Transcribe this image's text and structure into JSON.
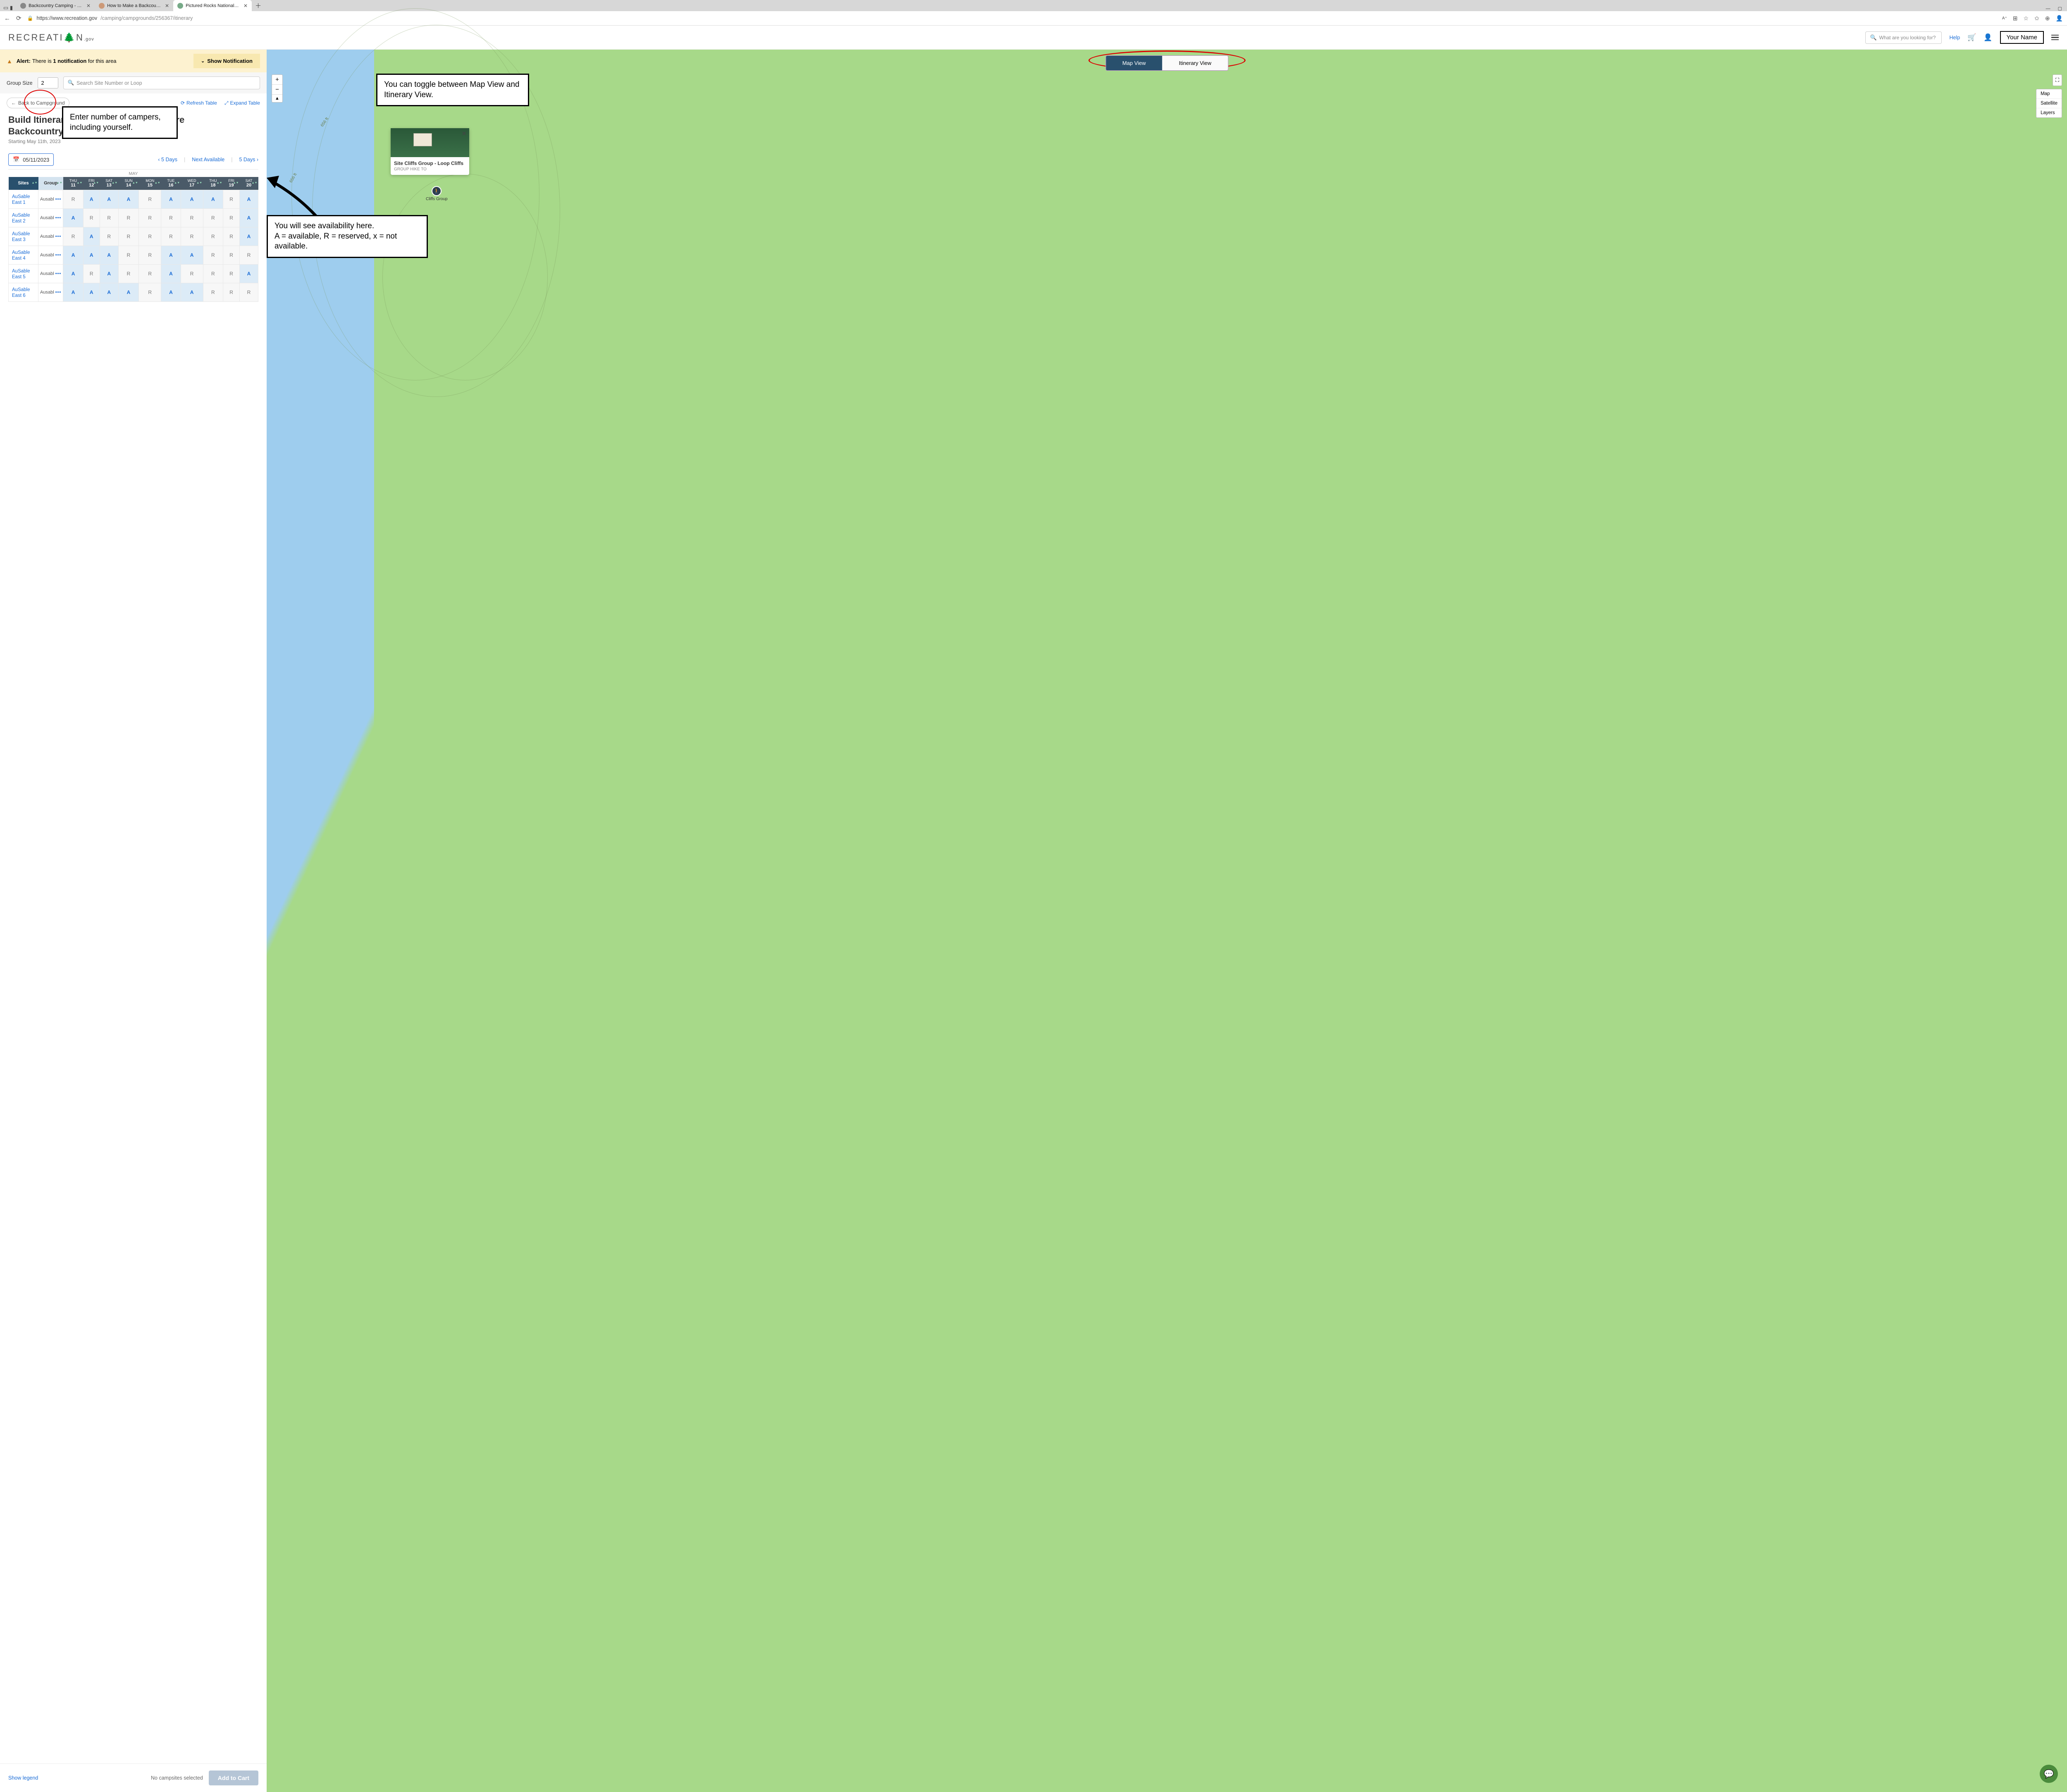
{
  "browser": {
    "tabs": [
      {
        "title": "Backcountry Camping - Pictured"
      },
      {
        "title": "How to Make a Backcountry Cam"
      },
      {
        "title": "Pictured Rocks National Lakesho"
      }
    ],
    "url_host": "https://www.recreation.gov",
    "url_path": "/camping/campgrounds/256367/itinerary"
  },
  "header": {
    "logo_main": "RECREATI",
    "logo_o": "☼",
    "logo_n": "N",
    "logo_gov": ".gov",
    "search_placeholder": "What are you looking for?",
    "help": "Help",
    "your_name": "Your Name"
  },
  "alert": {
    "label": "Alert:",
    "text_pre": "There is ",
    "count": "1 notification",
    "text_post": " for this area",
    "show": "Show Notification"
  },
  "filters": {
    "group_label": "Group Size",
    "group_value": "2",
    "site_search_placeholder": "Search Site Number or Loop"
  },
  "actions": {
    "back": "Back to Campground",
    "refresh": "Refresh Table",
    "expand": "Expand Table"
  },
  "title_block": {
    "line1": "Build Itinerary",
    "line2_visible": "keshore",
    "line3": "Backcountry (",
    "full_hidden": "Build Itinerary - Pictured Rocks National Lakeshore Backcountry Camping",
    "start": "Starting May 11th, 2023"
  },
  "date_nav": {
    "date": "05/11/2023",
    "prev": "5 Days",
    "next_avail": "Next Available",
    "next": "5 Days"
  },
  "month_label": "MAY",
  "columns": {
    "sites": "Sites",
    "group": "Group",
    "days": [
      {
        "dow": "THU",
        "num": "11"
      },
      {
        "dow": "FRI",
        "num": "12"
      },
      {
        "dow": "SAT",
        "num": "13"
      },
      {
        "dow": "SUN",
        "num": "14"
      },
      {
        "dow": "MON",
        "num": "15"
      },
      {
        "dow": "TUE",
        "num": "16"
      },
      {
        "dow": "WED",
        "num": "17"
      },
      {
        "dow": "THU",
        "num": "18"
      },
      {
        "dow": "FRI",
        "num": "19"
      },
      {
        "dow": "SAT",
        "num": "20"
      }
    ]
  },
  "rows": [
    {
      "site": "AuSable East 1",
      "group": "Ausabl",
      "cells": [
        "R",
        "A",
        "A",
        "A",
        "R",
        "A",
        "A",
        "A",
        "R",
        "A"
      ]
    },
    {
      "site": "AuSable East 2",
      "group": "Ausabl",
      "cells": [
        "A",
        "R",
        "R",
        "R",
        "R",
        "R",
        "R",
        "R",
        "R",
        "A"
      ]
    },
    {
      "site": "AuSable East 3",
      "group": "Ausabl",
      "cells": [
        "R",
        "A",
        "R",
        "R",
        "R",
        "R",
        "R",
        "R",
        "R",
        "A"
      ]
    },
    {
      "site": "AuSable East 4",
      "group": "Ausabl",
      "cells": [
        "A",
        "A",
        "A",
        "R",
        "R",
        "A",
        "A",
        "R",
        "R",
        "R"
      ]
    },
    {
      "site": "AuSable East 5",
      "group": "Ausabl",
      "cells": [
        "A",
        "R",
        "A",
        "R",
        "R",
        "A",
        "R",
        "R",
        "R",
        "A"
      ]
    },
    {
      "site": "AuSable East 6",
      "group": "Ausabl",
      "cells": [
        "A",
        "A",
        "A",
        "A",
        "R",
        "A",
        "A",
        "R",
        "R",
        "R"
      ]
    }
  ],
  "footer": {
    "legend": "Show legend",
    "none": "No campsites selected",
    "add": "Add to Cart"
  },
  "map": {
    "toggle_map": "Map View",
    "toggle_itin": "Itinerary View",
    "layers": [
      "Map",
      "Satellite",
      "Layers"
    ],
    "elev1": "656 ft",
    "elev2": "656 ft",
    "popup_title": "Site Cliffs Group - Loop Cliffs",
    "popup_sub": "GROUP HIKE TO",
    "marker_label": "Cliffs Group"
  },
  "callouts": {
    "c1": "Enter number of campers, including yourself.",
    "c2": "You can toggle between Map View and Itinerary View.",
    "c3": "You will see availability here.\nA = available, R = reserved, x = not available."
  }
}
